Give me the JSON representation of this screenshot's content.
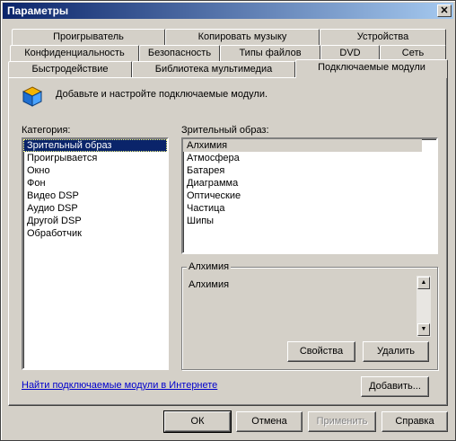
{
  "window": {
    "title": "Параметры",
    "close_glyph": "✕"
  },
  "tabs": {
    "row1": [
      "Проигрыватель",
      "Копировать музыку",
      "Устройства"
    ],
    "row2": [
      "Конфиденциальность",
      "Безопасность",
      "Типы файлов",
      "DVD",
      "Сеть"
    ],
    "row3": [
      "Быстродействие",
      "Библиотека мультимедиа",
      "Подключаемые модули"
    ]
  },
  "header": {
    "description": "Добавьте и настройте подключаемые модули."
  },
  "category": {
    "label": "Категория:",
    "items": [
      "Зрительный образ",
      "Проигрывается",
      "Окно",
      "Фон",
      "Видео DSP",
      "Аудио DSP",
      "Другой DSP",
      "Обработчик"
    ],
    "selected_index": 0
  },
  "plugins": {
    "label": "Зрительный образ:",
    "items": [
      "Алхимия",
      "Атмосфера",
      "Батарея",
      "Диаграмма",
      "Оптические",
      "Частица",
      "Шипы"
    ],
    "selected_index": 0
  },
  "details": {
    "group_title": "Алхимия",
    "description": "Алхимия",
    "properties_label": "Свойства",
    "remove_label": "Удалить"
  },
  "footer": {
    "link_text": "Найти подключаемые модули в Интернете",
    "add_label": "Добавить..."
  },
  "buttons": {
    "ok": "ОК",
    "cancel": "Отмена",
    "apply": "Применить",
    "help": "Справка"
  }
}
